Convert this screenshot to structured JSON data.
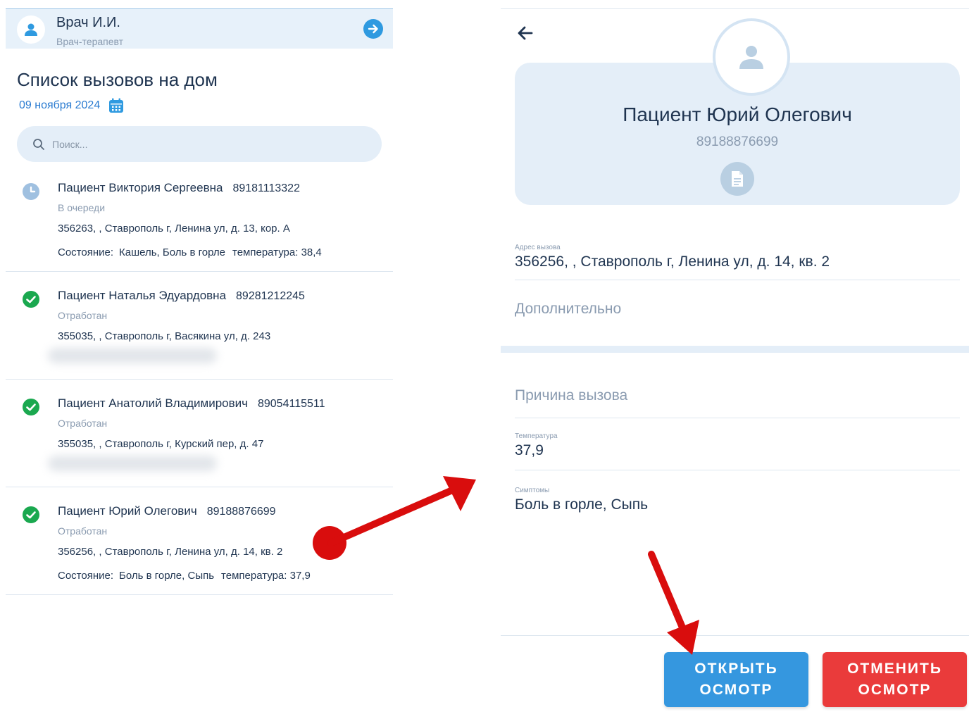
{
  "doctor": {
    "name": "Врач И.И.",
    "role": "Врач-терапевт"
  },
  "list": {
    "title": "Список вызовов на дом",
    "date": "09 ноября 2024",
    "search_placeholder": "Поиск...",
    "calls": [
      {
        "name": "Пациент Виктория Сергеевна",
        "phone": "89181113322",
        "status": "В очереди",
        "status_kind": "clock-icon",
        "address": "356263, , Ставрополь г, Ленина ул, д. 13, кор. А",
        "condition_label": "Состояние:",
        "condition": "Кашель, Боль в горле",
        "temperature": "температура: 38,4"
      },
      {
        "name": "Пациент Наталья Эдуардовна",
        "phone": "89281212245",
        "status": "Отработан",
        "status_kind": "check-circle-icon",
        "address": "355035, , Ставрополь г, Васякина ул, д. 243"
      },
      {
        "name": "Пациент Анатолий Владимирович",
        "phone": "89054115511",
        "status": "Отработан",
        "status_kind": "check-circle-icon",
        "address": "355035, , Ставрополь г, Курский пер, д. 47"
      },
      {
        "name": "Пациент Юрий Олегович",
        "phone": "89188876699",
        "status": "Отработан",
        "status_kind": "check-circle-icon",
        "address": "356256, , Ставрополь г, Ленина ул, д. 14, кв. 2",
        "condition_label": "Состояние:",
        "condition": "Боль в горле, Сыпь",
        "temperature": "температура: 37,9"
      }
    ]
  },
  "detail": {
    "patient_name": "Пациент Юрий Олегович",
    "patient_phone": "89188876699",
    "address_label": "Адрес вызова",
    "address": "356256, , Ставрополь г, Ленина ул, д. 14, кв. 2",
    "additional_label": "Дополнительно",
    "reason_label": "Причина вызова",
    "temperature_label": "Температура",
    "temperature": "37,9",
    "symptoms_label": "Симптомы",
    "symptoms": "Боль в горле, Сыпь",
    "open_button": [
      "ОТКРЫТЬ",
      "ОСМОТР"
    ],
    "cancel_button": [
      "ОТМЕНИТЬ",
      "ОСМОТР"
    ]
  },
  "colors": {
    "accent": "#3597df",
    "danger": "#ea3b3b",
    "success": "#1aa84f",
    "queue": "#9fc0e0",
    "annotation": "#d90d0d"
  }
}
